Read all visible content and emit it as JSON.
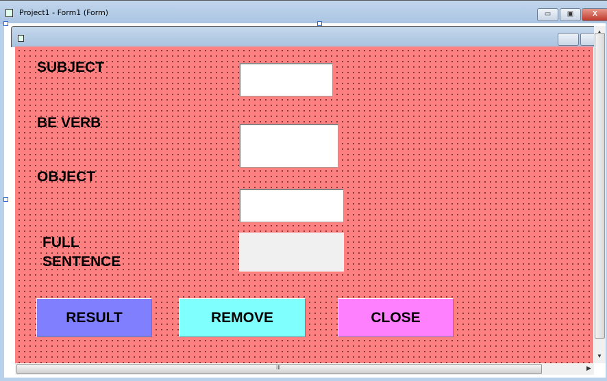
{
  "window": {
    "title": "Project1 - Form1 (Form)",
    "minimize": "▭",
    "maximize": "▣",
    "close": "X"
  },
  "form": {
    "labels": {
      "subject": "SUBJECT",
      "be_verb": "BE VERB",
      "object": "OBJECT",
      "full_sentence_1": "FULL",
      "full_sentence_2": "SENTENCE"
    },
    "inputs": {
      "subject": "",
      "be_verb": "",
      "object": "",
      "full_sentence": ""
    },
    "buttons": {
      "result": "RESULT",
      "remove": "REMOVE",
      "close": "CLOSE"
    },
    "colors": {
      "background": "#ff8080",
      "result": "#8080ff",
      "remove": "#80ffff",
      "close": "#ff80ff"
    }
  },
  "scrollbar": {
    "grip": "III"
  }
}
